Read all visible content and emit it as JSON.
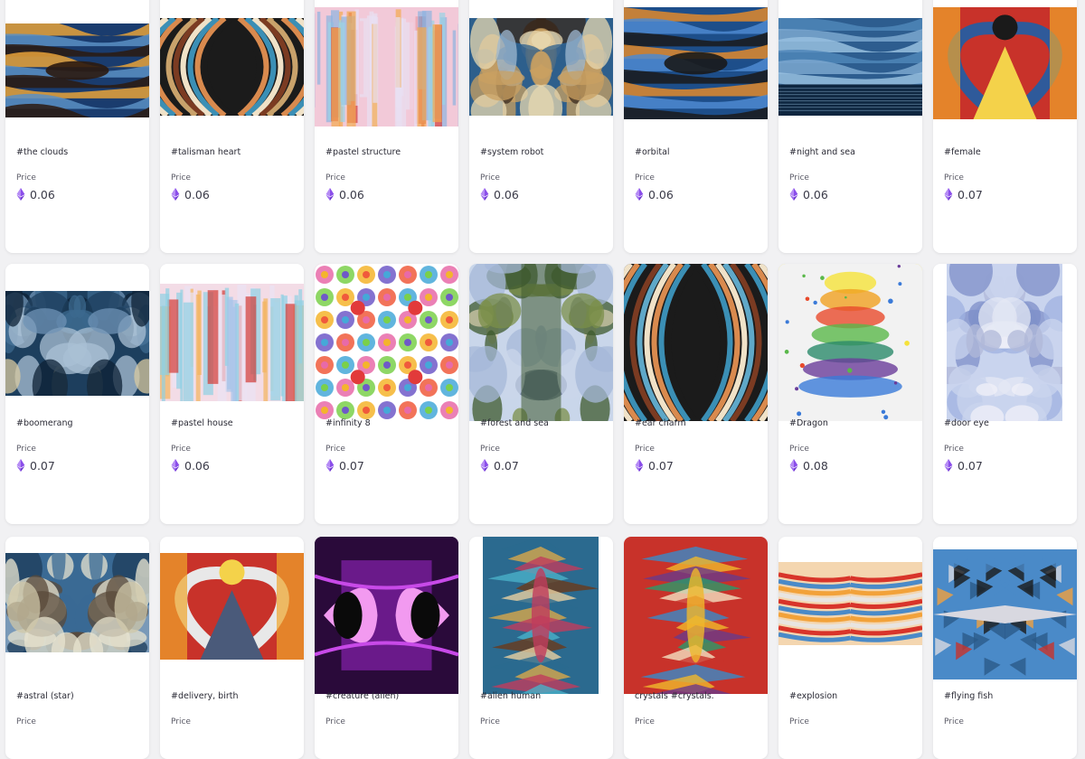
{
  "currency_icon": "ethereum-icon",
  "price_label": "Price",
  "colors": {
    "card_bg": "#ffffff",
    "page_bg": "#f1f1f3",
    "eth_accent": "#7b3fe4"
  },
  "items": [
    {
      "title": "#the clouds",
      "price": "0.06"
    },
    {
      "title": "#talisman heart",
      "price": "0.06"
    },
    {
      "title": "#pastel structure",
      "price": "0.06"
    },
    {
      "title": "#system robot",
      "price": "0.06"
    },
    {
      "title": "#orbital",
      "price": "0.06"
    },
    {
      "title": "#night and sea",
      "price": "0.06"
    },
    {
      "title": "#female",
      "price": "0.07"
    },
    {
      "title": "#boomerang",
      "price": "0.07"
    },
    {
      "title": "#pastel house",
      "price": "0.06"
    },
    {
      "title": "#infinity 8",
      "price": "0.07"
    },
    {
      "title": "#forest and sea",
      "price": "0.07"
    },
    {
      "title": "#ear charm",
      "price": "0.07"
    },
    {
      "title": "#Dragon",
      "price": "0.08"
    },
    {
      "title": "#door eye",
      "price": "0.07"
    },
    {
      "title": "#astral (star)",
      "price": ""
    },
    {
      "title": "#delivery, birth",
      "price": ""
    },
    {
      "title": "#creature (alien)",
      "price": ""
    },
    {
      "title": "#alien human",
      "price": ""
    },
    {
      "title": "crystals #crystals.",
      "price": ""
    },
    {
      "title": "#explosion",
      "price": ""
    },
    {
      "title": "#flying fish",
      "price": ""
    }
  ]
}
